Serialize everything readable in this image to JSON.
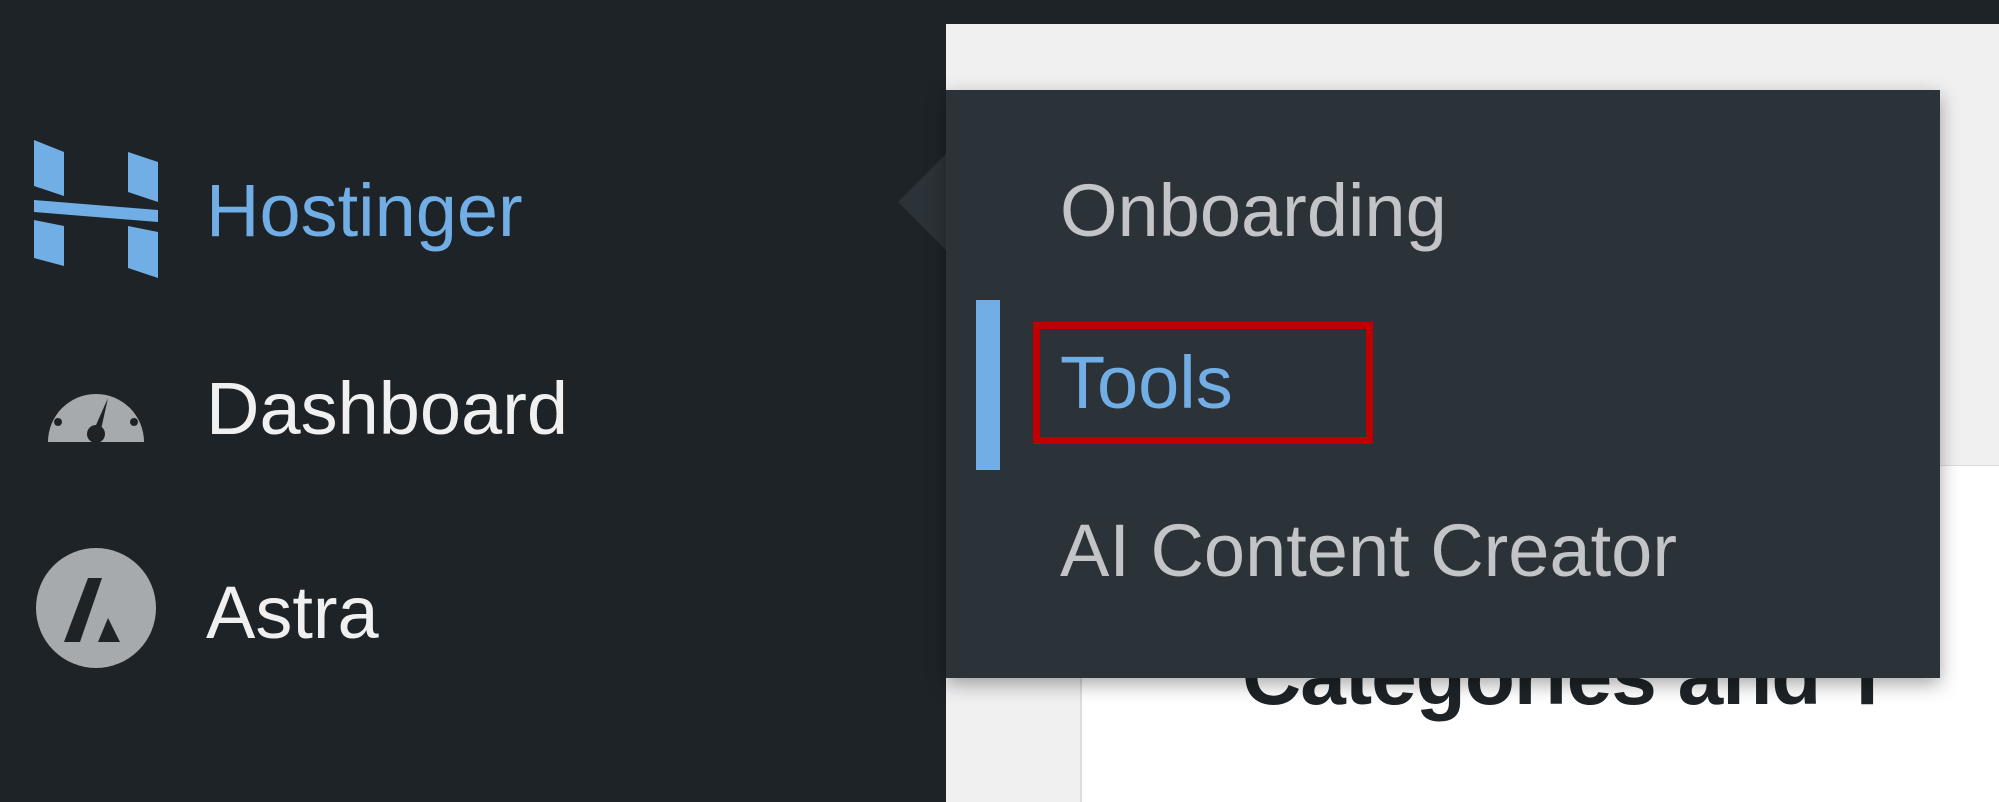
{
  "sidebar": {
    "items": [
      {
        "label": "Hostinger",
        "icon": "hostinger-logo-icon",
        "current": true
      },
      {
        "label": "Dashboard",
        "icon": "dashboard-gauge-icon",
        "current": false
      },
      {
        "label": "Astra",
        "icon": "astra-logo-icon",
        "current": false
      }
    ]
  },
  "flyout": {
    "items": [
      {
        "label": "Onboarding",
        "active": false
      },
      {
        "label": "Tools",
        "active": true
      },
      {
        "label": "AI Content Creator",
        "active": false
      }
    ]
  },
  "content": {
    "card_title": "Categories and T"
  },
  "colors": {
    "sidebar_bg": "#1d2327",
    "flyout_bg": "#2c3338",
    "accent": "#72aee6",
    "highlight": "#c00000",
    "text": "#f0f0f1",
    "submenu_text": "#c3c4c7"
  }
}
